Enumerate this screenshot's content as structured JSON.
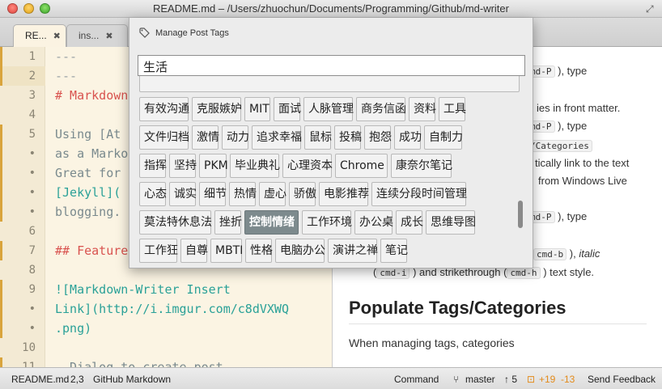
{
  "window": {
    "title": "README.md – /Users/zhuochun/Documents/Programming/Github/md-writer"
  },
  "tabs": [
    {
      "label": "RE...",
      "close": "✖"
    },
    {
      "label": "ins...",
      "close": "✖"
    }
  ],
  "editor": {
    "line_numbers": [
      "1",
      "2",
      "3",
      "4",
      "5",
      "•",
      "•",
      "•",
      "•",
      "6",
      "7",
      "8",
      "9",
      "•",
      "•",
      "10",
      "11"
    ],
    "lines": [
      {
        "text": "---"
      },
      {
        "text": "---"
      },
      {
        "text": "# Markdown"
      },
      {
        "text": ""
      },
      {
        "text": "Using [At"
      },
      {
        "text": "as a Marko"
      },
      {
        "text": "Great for"
      },
      {
        "text": "[Jekyll]("
      },
      {
        "text": "blogging."
      },
      {
        "text": ""
      },
      {
        "text": "## Feature"
      },
      {
        "text": ""
      },
      {
        "text": "![Markdown-Writer Insert"
      },
      {
        "text": "Link](http://i.imgur.com/c8dVXWQ"
      },
      {
        "text": ".png)"
      },
      {
        "text": ""
      },
      {
        "text": "- Dialog to create post"
      }
    ]
  },
  "preview": {
    "p1_kbd": "md-P",
    "p1_rest": "), type",
    "p2": "ies in front matter.",
    "p3_kbd": "md-P",
    "p3_rest": "), type",
    "p4_kbd": "/Categories",
    "p5": "tically link to the text",
    "p6": "from Windows Live",
    "p7_kbd": "md-P",
    "p7_rest": "), type",
    "p8_kbd": "cmd-b",
    "p8_rest": "),",
    "p8_italic": "italic",
    "p9_kbd1": "cmd-i",
    "p9_mid": ") and strikethrough (",
    "p9_kbd2": "cmd-h",
    "p9_rest": ") text style.",
    "heading": "Populate Tags/Categories",
    "para": "When managing tags, categories"
  },
  "dialog": {
    "title": "Manage Post Tags",
    "input_value": "生活",
    "tags": [
      [
        "有效沟通",
        "克服嫉妒",
        "MIT",
        "面试",
        "人脉管理",
        "商务信函",
        "资料",
        "工具"
      ],
      [
        "文件归档",
        "激情",
        "动力",
        "追求幸福",
        "鼠标",
        "投稿",
        "抱怨",
        "成功",
        "自制力"
      ],
      [
        "指挥",
        "坚持",
        "PKM",
        "毕业典礼",
        "心理资本",
        "Chrome",
        "康奈尔笔记"
      ],
      [
        "心态",
        "诚实",
        "细节",
        "热情",
        "虚心",
        "骄傲",
        "电影推荐",
        "连续分段时间管理"
      ],
      [
        "莫法特休息法",
        "挫折",
        "控制情绪",
        "工作环境",
        "办公桌",
        "成长",
        "思维导图"
      ],
      [
        "工作狂",
        "自尊",
        "MBTI",
        "性格",
        "电脑办公",
        "演讲之禅",
        "笔记"
      ]
    ],
    "selected_tag": "控制情绪"
  },
  "statusbar": {
    "file": "README.md",
    "cursor": "2,3",
    "grammar": "GitHub Markdown",
    "command": "Command",
    "branch": "master",
    "ahead": "↑ 5",
    "added": "+19",
    "removed": "-13",
    "feedback": "Send Feedback"
  }
}
